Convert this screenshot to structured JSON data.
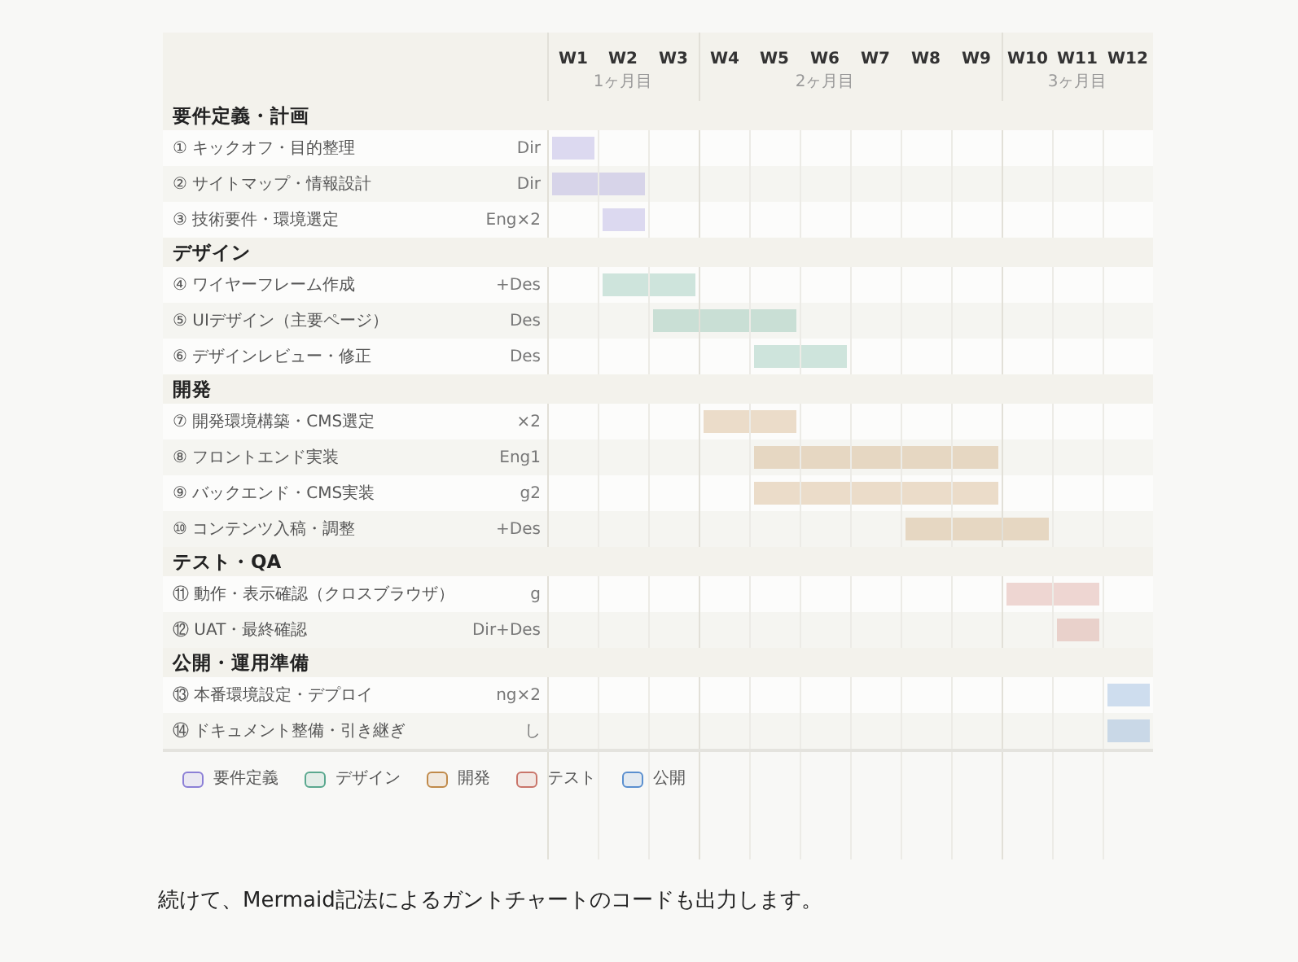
{
  "weeks": [
    {
      "label": "W1",
      "month_start": true
    },
    {
      "label": "W2",
      "month": "1ヶ月目",
      "month_start": false
    },
    {
      "label": "W3",
      "month_start": false
    },
    {
      "label": "W4",
      "month_start": true
    },
    {
      "label": "W5",
      "month_start": false
    },
    {
      "label": "W6",
      "month": "2ヶ月目",
      "month_start": false
    },
    {
      "label": "W7",
      "month_start": false
    },
    {
      "label": "W8",
      "month_start": false
    },
    {
      "label": "W9",
      "month_start": false
    },
    {
      "label": "W10",
      "month_start": true
    },
    {
      "label": "W11",
      "month": "3ヶ月目",
      "month_start": false
    },
    {
      "label": "W12",
      "month_start": false
    }
  ],
  "phases": [
    {
      "title": "要件定義・計画",
      "tasks": [
        {
          "name": "① キックオフ・目的整理",
          "role": "Dir",
          "weeks": [
            true,
            false,
            false,
            false,
            false,
            false,
            false,
            false,
            false,
            false,
            false,
            false
          ]
        },
        {
          "name": "② サイトマップ・情報設計",
          "role": "Dir",
          "weeks": [
            true,
            true,
            false,
            false,
            false,
            false,
            false,
            false,
            false,
            false,
            false,
            false
          ]
        },
        {
          "name": "③ 技術要件・環境選定",
          "role": "Eng×2",
          "weeks": [
            false,
            true,
            false,
            false,
            false,
            false,
            false,
            false,
            false,
            false,
            false,
            false
          ]
        }
      ]
    },
    {
      "title": "デザイン",
      "tasks": [
        {
          "name": "④ ワイヤーフレーム作成",
          "role": "+Des",
          "weeks": [
            false,
            true,
            true,
            false,
            false,
            false,
            false,
            false,
            false,
            false,
            false,
            false
          ]
        },
        {
          "name": "⑤ UIデザイン（主要ページ）",
          "role": "Des",
          "weeks": [
            false,
            false,
            true,
            true,
            true,
            false,
            false,
            false,
            false,
            false,
            false,
            false
          ]
        },
        {
          "name": "⑥ デザインレビュー・修正",
          "role": "Des",
          "weeks": [
            false,
            false,
            false,
            false,
            true,
            true,
            false,
            false,
            false,
            false,
            false,
            false
          ]
        }
      ]
    },
    {
      "title": "開発",
      "tasks": [
        {
          "name": "⑦ 開発環境構築・CMS選定",
          "role": "×2",
          "weeks": [
            false,
            false,
            false,
            true,
            true,
            false,
            false,
            false,
            false,
            false,
            false,
            false
          ]
        },
        {
          "name": "⑧ フロントエンド実装",
          "role": "Eng1",
          "weeks": [
            false,
            false,
            false,
            false,
            true,
            true,
            true,
            true,
            true,
            false,
            false,
            false
          ]
        },
        {
          "name": "⑨ バックエンド・CMS実装",
          "role": "g2",
          "weeks": [
            false,
            false,
            false,
            false,
            true,
            true,
            true,
            true,
            true,
            false,
            false,
            false
          ]
        },
        {
          "name": "⑩ コンテンツ入稿・調整",
          "role": "+Des",
          "weeks": [
            false,
            false,
            false,
            false,
            false,
            false,
            false,
            true,
            true,
            true,
            false,
            false
          ]
        }
      ]
    },
    {
      "title": "テスト・QA",
      "tasks": [
        {
          "name": "⑪ 動作・表示確認（クロスブラウザ）",
          "role": "g",
          "weeks": [
            false,
            false,
            false,
            false,
            false,
            false,
            false,
            false,
            false,
            true,
            true,
            false
          ]
        },
        {
          "name": "⑫ UAT・最終確認",
          "role": "Dir+Des",
          "weeks": [
            false,
            false,
            false,
            false,
            false,
            false,
            false,
            false,
            false,
            false,
            true,
            false
          ]
        }
      ]
    },
    {
      "title": "公開・運用準備",
      "tasks": [
        {
          "name": "⑬ 本番環境設定・デプロイ",
          "role": "ng×2",
          "weeks": [
            false,
            false,
            false,
            false,
            false,
            false,
            false,
            false,
            false,
            false,
            false,
            true
          ]
        },
        {
          "name": "⑭ ドキュメント整備・引き継ぎ",
          "role": "し",
          "weeks": [
            false,
            false,
            false,
            false,
            false,
            false,
            false,
            false,
            false,
            false,
            false,
            true
          ]
        }
      ]
    }
  ],
  "legend": [
    {
      "label": "要件定義",
      "color": "#8b7fd6"
    },
    {
      "label": "デザイン",
      "color": "#5aa88f"
    },
    {
      "label": "開発",
      "color": "#c08a4a"
    },
    {
      "label": "テスト",
      "color": "#c9756a"
    },
    {
      "label": "公開",
      "color": "#5a8fcf"
    }
  ],
  "footer": "続けて、Mermaid記法によるガントチャートのコードも出力します。"
}
